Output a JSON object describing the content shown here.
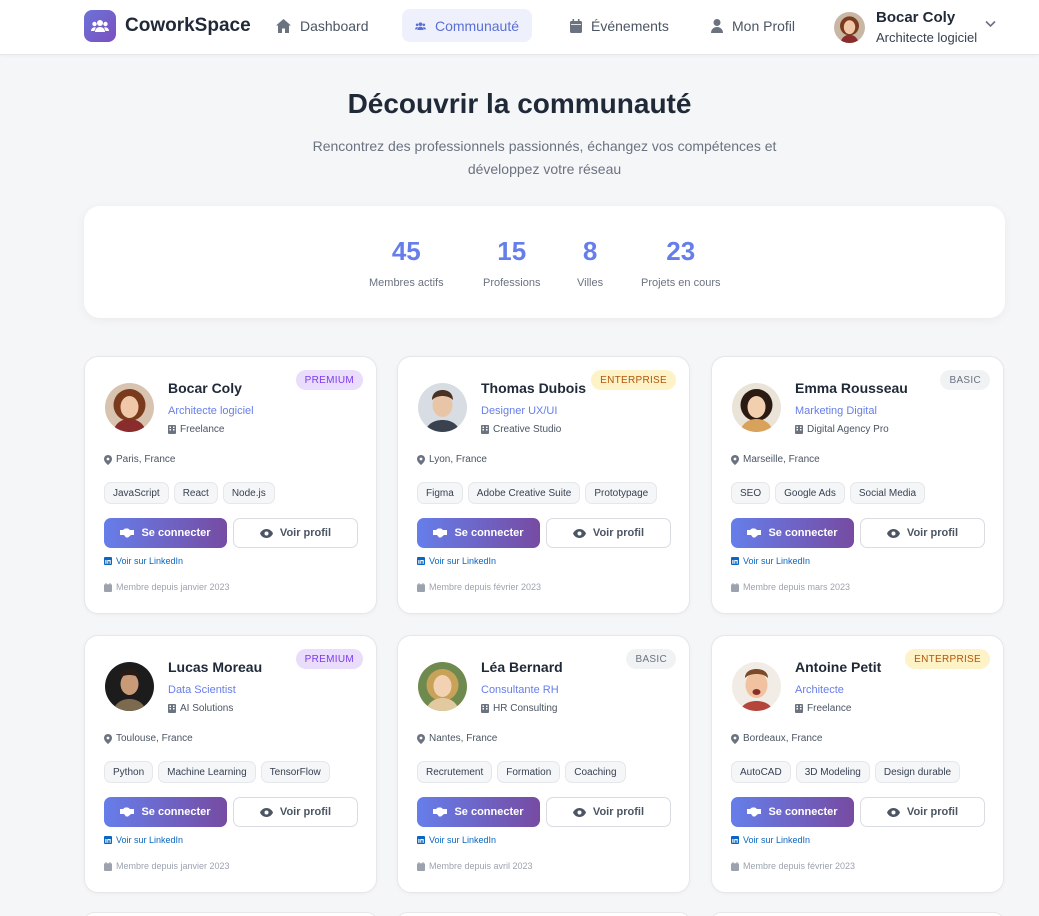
{
  "app": {
    "name": "CoworkSpace",
    "logo_icon": "users-icon",
    "accent": "#667eea",
    "accent_end": "#764ba2"
  },
  "nav": [
    {
      "label": "Dashboard",
      "icon": "home-icon",
      "active": false
    },
    {
      "label": "Communauté",
      "icon": "users-icon",
      "active": true
    },
    {
      "label": "Événements",
      "icon": "calendar-icon",
      "active": false
    },
    {
      "label": "Mon Profil",
      "icon": "user-icon",
      "active": false
    }
  ],
  "user": {
    "name": "Bocar Coly",
    "role": "Architecte logiciel"
  },
  "page": {
    "title": "Découvrir la communauté",
    "subtitle": "Rencontrez des professionnels passionnés, échangez vos compétences et développez votre réseau"
  },
  "stats": [
    {
      "value": "45",
      "label": "Membres actifs"
    },
    {
      "value": "15",
      "label": "Professions"
    },
    {
      "value": "8",
      "label": "Villes"
    },
    {
      "value": "23",
      "label": "Projets en cours"
    }
  ],
  "actions": {
    "connect": "Se connecter",
    "view": "Voir profil",
    "linkedin": "Voir sur LinkedIn"
  },
  "members": [
    {
      "name": "Bocar Coly",
      "role": "Architecte logiciel",
      "company": "Freelance",
      "location": "Paris, France",
      "plan": "PREMIUM",
      "skills": [
        "JavaScript",
        "React",
        "Node.js"
      ],
      "since": "Membre depuis janvier 2023"
    },
    {
      "name": "Thomas Dubois",
      "role": "Designer UX/UI",
      "company": "Creative Studio",
      "location": "Lyon, France",
      "plan": "ENTERPRISE",
      "skills": [
        "Figma",
        "Adobe Creative Suite",
        "Prototypage"
      ],
      "since": "Membre depuis février 2023"
    },
    {
      "name": "Emma Rousseau",
      "role": "Marketing Digital",
      "company": "Digital Agency Pro",
      "location": "Marseille, France",
      "plan": "BASIC",
      "skills": [
        "SEO",
        "Google Ads",
        "Social Media"
      ],
      "since": "Membre depuis mars 2023"
    },
    {
      "name": "Lucas Moreau",
      "role": "Data Scientist",
      "company": "AI Solutions",
      "location": "Toulouse, France",
      "plan": "PREMIUM",
      "skills": [
        "Python",
        "Machine Learning",
        "TensorFlow"
      ],
      "since": "Membre depuis janvier 2023"
    },
    {
      "name": "Léa Bernard",
      "role": "Consultante RH",
      "company": "HR Consulting",
      "location": "Nantes, France",
      "plan": "BASIC",
      "skills": [
        "Recrutement",
        "Formation",
        "Coaching"
      ],
      "since": "Membre depuis avril 2023"
    },
    {
      "name": "Antoine Petit",
      "role": "Architecte",
      "company": "Freelance",
      "location": "Bordeaux, France",
      "plan": "ENTERPRISE",
      "skills": [
        "AutoCAD",
        "3D Modeling",
        "Design durable"
      ],
      "since": "Membre depuis février 2023"
    }
  ]
}
